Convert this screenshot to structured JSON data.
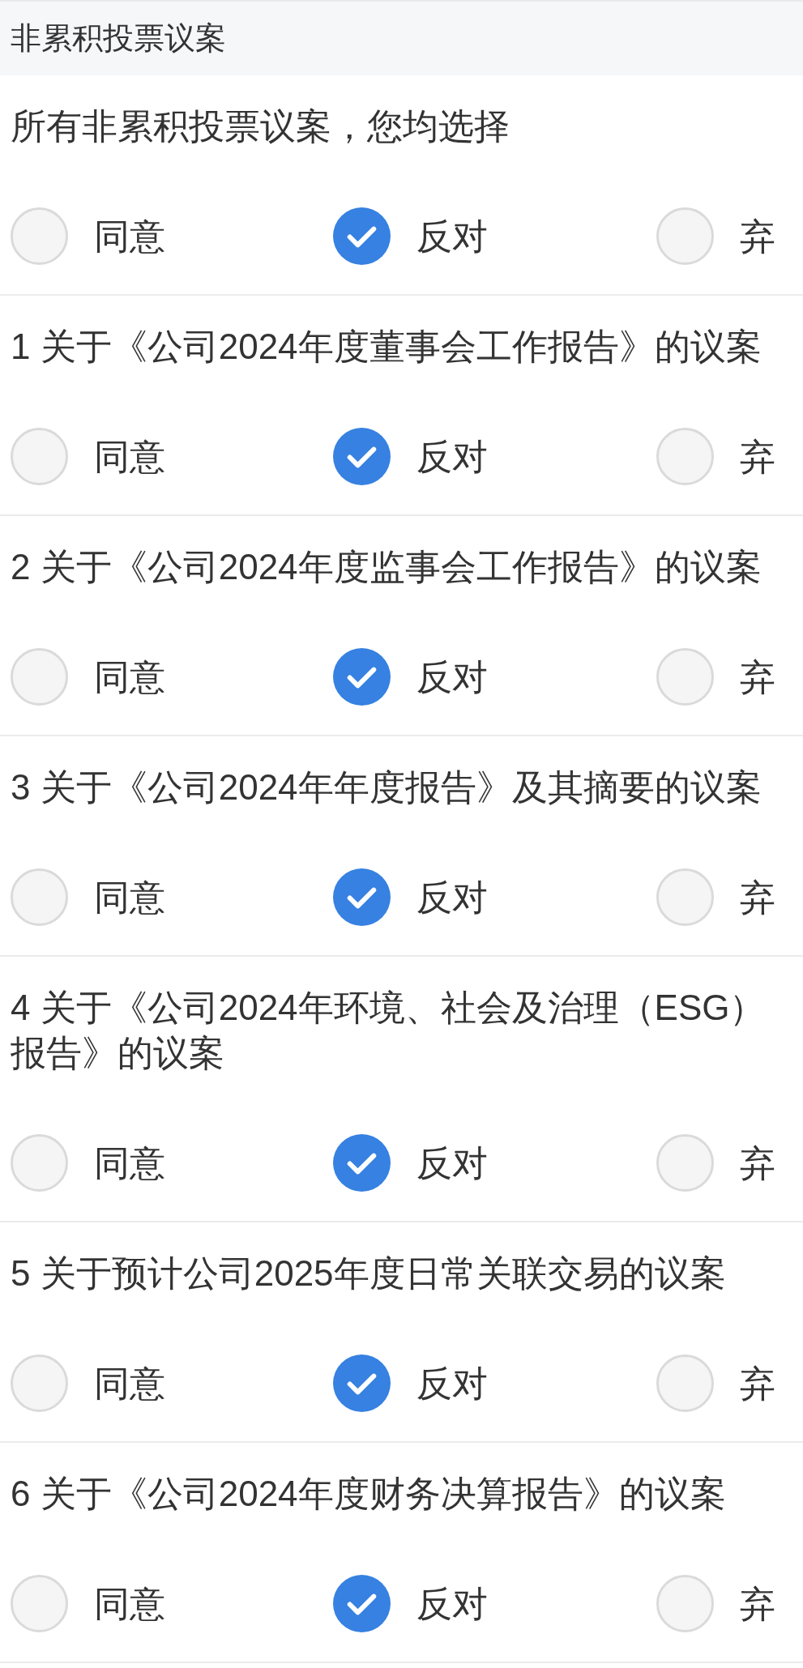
{
  "header": {
    "title": "非累积投票议案"
  },
  "groups": [
    {
      "question": "所有非累积投票议案，您均选择",
      "options": [
        {
          "label": "同意",
          "selected": false
        },
        {
          "label": "反对",
          "selected": true
        },
        {
          "label": "弃",
          "selected": false
        }
      ]
    },
    {
      "question": "1 关于《公司2024年度董事会工作报告》的议案",
      "options": [
        {
          "label": "同意",
          "selected": false
        },
        {
          "label": "反对",
          "selected": true
        },
        {
          "label": "弃",
          "selected": false
        }
      ]
    },
    {
      "question": "2 关于《公司2024年度监事会工作报告》的议案",
      "options": [
        {
          "label": "同意",
          "selected": false
        },
        {
          "label": "反对",
          "selected": true
        },
        {
          "label": "弃",
          "selected": false
        }
      ]
    },
    {
      "question": "3 关于《公司2024年年度报告》及其摘要的议案",
      "options": [
        {
          "label": "同意",
          "selected": false
        },
        {
          "label": "反对",
          "selected": true
        },
        {
          "label": "弃",
          "selected": false
        }
      ]
    },
    {
      "question": "4 关于《公司2024年环境、社会及治理（ESG）报告》的议案",
      "options": [
        {
          "label": "同意",
          "selected": false
        },
        {
          "label": "反对",
          "selected": true
        },
        {
          "label": "弃",
          "selected": false
        }
      ]
    },
    {
      "question": "5 关于预计公司2025年度日常关联交易的议案",
      "options": [
        {
          "label": "同意",
          "selected": false
        },
        {
          "label": "反对",
          "selected": true
        },
        {
          "label": "弃",
          "selected": false
        }
      ]
    },
    {
      "question": "6 关于《公司2024年度财务决算报告》的议案",
      "options": [
        {
          "label": "同意",
          "selected": false
        },
        {
          "label": "反对",
          "selected": true
        },
        {
          "label": "弃",
          "selected": false
        }
      ]
    }
  ]
}
